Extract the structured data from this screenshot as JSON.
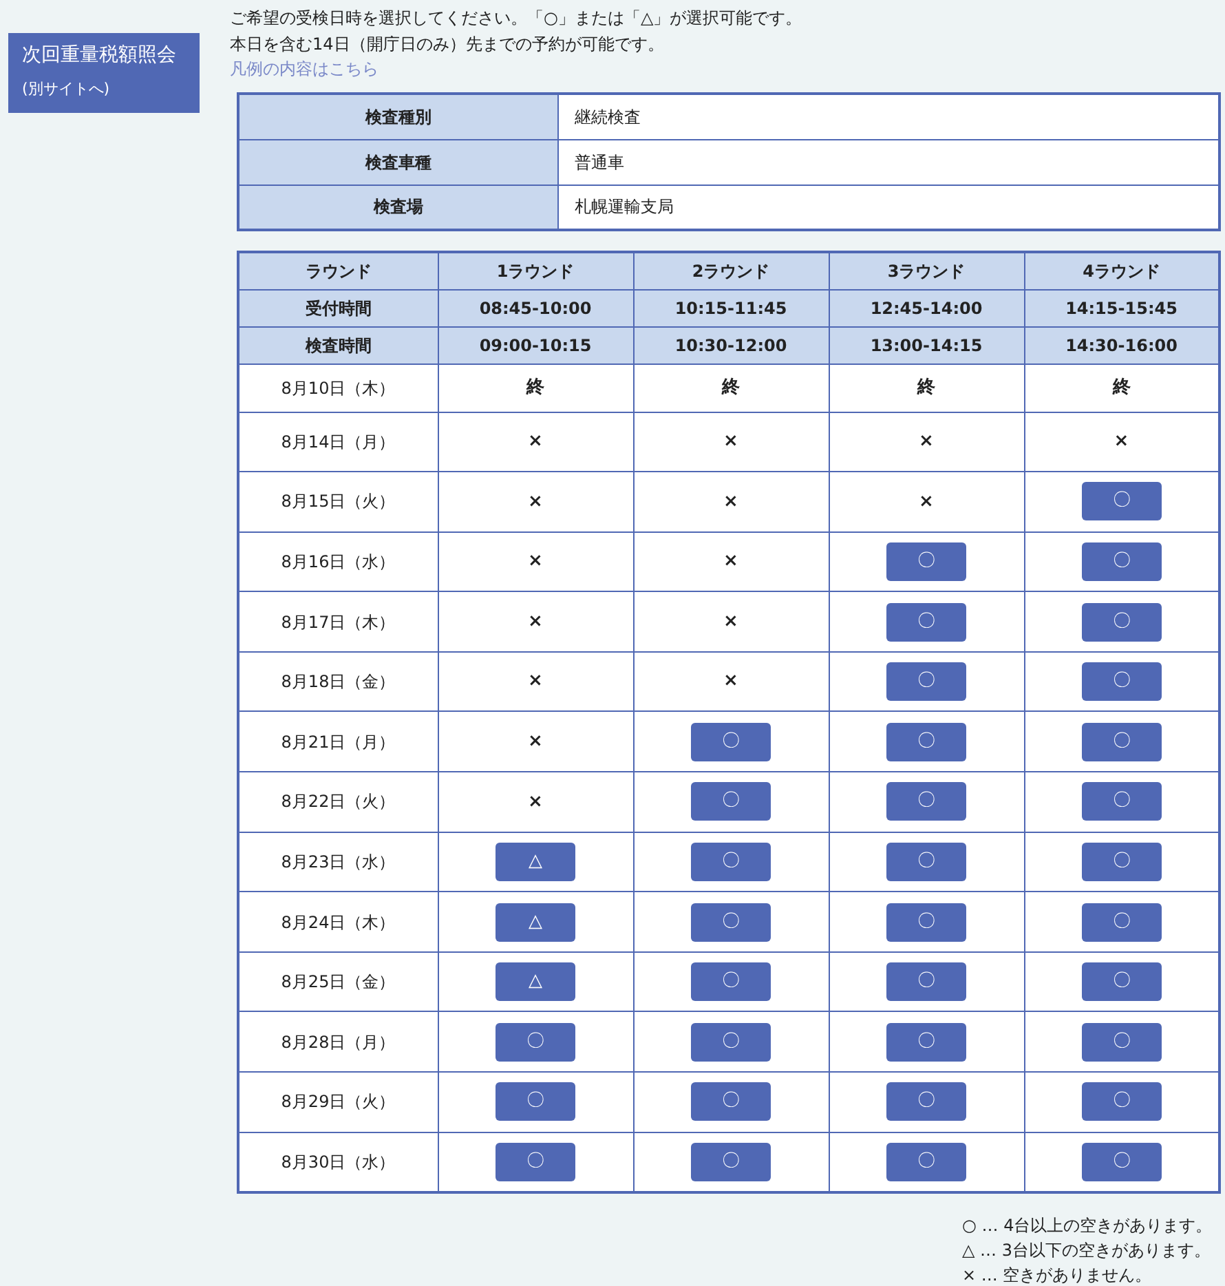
{
  "sidebar": {
    "button": {
      "title": "次回重量税額照会",
      "subtitle": "(別サイトへ)"
    }
  },
  "intro": {
    "lines": [
      "ご希望の受検日時を選択してください。「○」または「△」が選択可能です。",
      "本日を含む14日（開庁日のみ）先までの予約が可能です。"
    ],
    "legend_link": "凡例の内容はこちら"
  },
  "info_table": [
    {
      "label": "検査種別",
      "value": "継続検査"
    },
    {
      "label": "検査車種",
      "value": "普通車"
    },
    {
      "label": "検査場",
      "value": "札幌運輸支局"
    }
  ],
  "schedule": {
    "header_rows": [
      [
        "ラウンド",
        "1ラウンド",
        "2ラウンド",
        "3ラウンド",
        "4ラウンド"
      ],
      [
        "受付時間",
        "08:45-10:00",
        "10:15-11:45",
        "12:45-14:00",
        "14:15-15:45"
      ],
      [
        "検査時間",
        "09:00-10:15",
        "10:30-12:00",
        "13:00-14:15",
        "14:30-16:00"
      ]
    ],
    "rows": [
      {
        "date": "8月10日（木）",
        "slots": [
          {
            "kind": "closed",
            "text": "終"
          },
          {
            "kind": "closed",
            "text": "終"
          },
          {
            "kind": "closed",
            "text": "終"
          },
          {
            "kind": "closed",
            "text": "終"
          }
        ]
      },
      {
        "date": "8月14日（月）",
        "slots": [
          {
            "kind": "full",
            "text": "×"
          },
          {
            "kind": "full",
            "text": "×"
          },
          {
            "kind": "full",
            "text": "×"
          },
          {
            "kind": "full",
            "text": "×"
          }
        ]
      },
      {
        "date": "8月15日（火）",
        "slots": [
          {
            "kind": "full",
            "text": "×"
          },
          {
            "kind": "full",
            "text": "×"
          },
          {
            "kind": "full",
            "text": "×"
          },
          {
            "kind": "open",
            "text": "〇"
          }
        ]
      },
      {
        "date": "8月16日（水）",
        "slots": [
          {
            "kind": "full",
            "text": "×"
          },
          {
            "kind": "full",
            "text": "×"
          },
          {
            "kind": "open",
            "text": "〇"
          },
          {
            "kind": "open",
            "text": "〇"
          }
        ]
      },
      {
        "date": "8月17日（木）",
        "slots": [
          {
            "kind": "full",
            "text": "×"
          },
          {
            "kind": "full",
            "text": "×"
          },
          {
            "kind": "open",
            "text": "〇"
          },
          {
            "kind": "open",
            "text": "〇"
          }
        ]
      },
      {
        "date": "8月18日（金）",
        "slots": [
          {
            "kind": "full",
            "text": "×"
          },
          {
            "kind": "full",
            "text": "×"
          },
          {
            "kind": "open",
            "text": "〇"
          },
          {
            "kind": "open",
            "text": "〇"
          }
        ]
      },
      {
        "date": "8月21日（月）",
        "slots": [
          {
            "kind": "full",
            "text": "×"
          },
          {
            "kind": "open",
            "text": "〇"
          },
          {
            "kind": "open",
            "text": "〇"
          },
          {
            "kind": "open",
            "text": "〇"
          }
        ]
      },
      {
        "date": "8月22日（火）",
        "slots": [
          {
            "kind": "full",
            "text": "×"
          },
          {
            "kind": "open",
            "text": "〇"
          },
          {
            "kind": "open",
            "text": "〇"
          },
          {
            "kind": "open",
            "text": "〇"
          }
        ]
      },
      {
        "date": "8月23日（水）",
        "slots": [
          {
            "kind": "open",
            "text": "△"
          },
          {
            "kind": "open",
            "text": "〇"
          },
          {
            "kind": "open",
            "text": "〇"
          },
          {
            "kind": "open",
            "text": "〇"
          }
        ]
      },
      {
        "date": "8月24日（木）",
        "slots": [
          {
            "kind": "open",
            "text": "△"
          },
          {
            "kind": "open",
            "text": "〇"
          },
          {
            "kind": "open",
            "text": "〇"
          },
          {
            "kind": "open",
            "text": "〇"
          }
        ]
      },
      {
        "date": "8月25日（金）",
        "slots": [
          {
            "kind": "open",
            "text": "△"
          },
          {
            "kind": "open",
            "text": "〇"
          },
          {
            "kind": "open",
            "text": "〇"
          },
          {
            "kind": "open",
            "text": "〇"
          }
        ]
      },
      {
        "date": "8月28日（月）",
        "slots": [
          {
            "kind": "open",
            "text": "〇"
          },
          {
            "kind": "open",
            "text": "〇"
          },
          {
            "kind": "open",
            "text": "〇"
          },
          {
            "kind": "open",
            "text": "〇"
          }
        ]
      },
      {
        "date": "8月29日（火）",
        "slots": [
          {
            "kind": "open",
            "text": "〇"
          },
          {
            "kind": "open",
            "text": "〇"
          },
          {
            "kind": "open",
            "text": "〇"
          },
          {
            "kind": "open",
            "text": "〇"
          }
        ]
      },
      {
        "date": "8月30日（水）",
        "slots": [
          {
            "kind": "open",
            "text": "〇"
          },
          {
            "kind": "open",
            "text": "〇"
          },
          {
            "kind": "open",
            "text": "〇"
          },
          {
            "kind": "open",
            "text": "〇"
          }
        ]
      }
    ]
  },
  "legend": [
    "○ … 4台以上の空きがあります。",
    "△ … 3台以下の空きがあります。",
    "× … 空きがありません。"
  ]
}
